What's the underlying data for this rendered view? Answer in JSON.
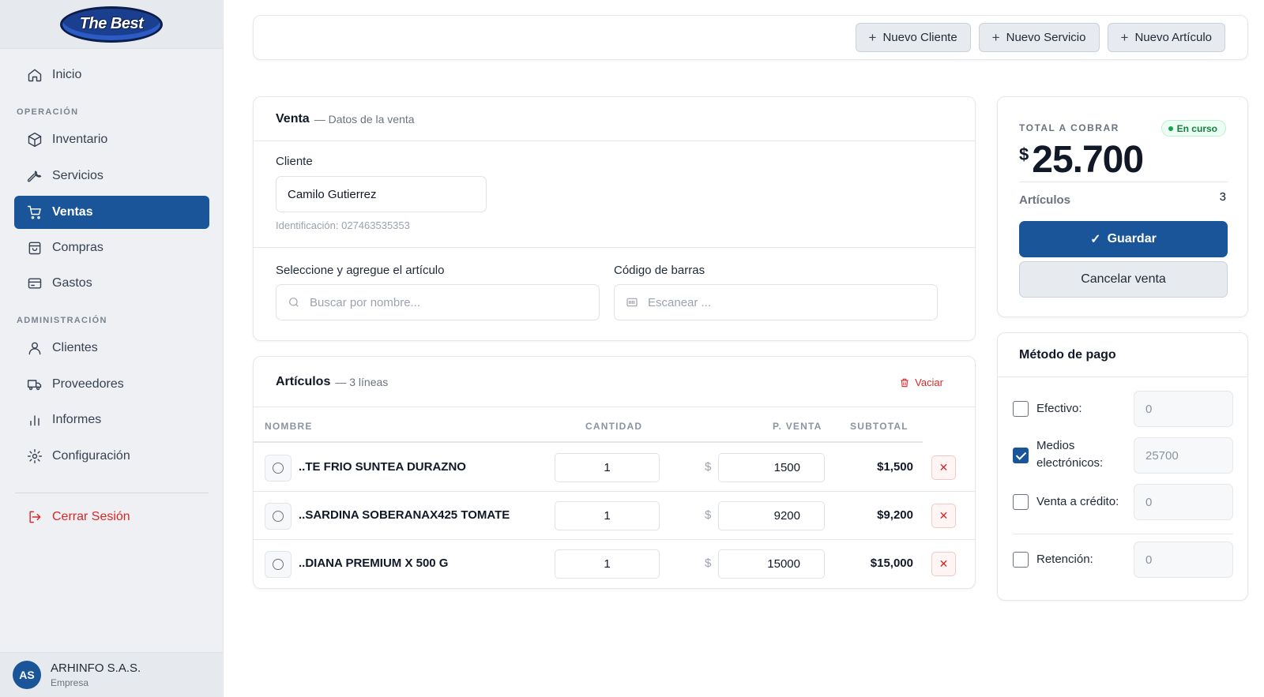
{
  "brand": {
    "logo_text": "The Best"
  },
  "sidebar": {
    "home": "Inicio",
    "section_operacion": "OPERACIÓN",
    "inventario": "Inventario",
    "servicios": "Servicios",
    "ventas": "Ventas",
    "compras": "Compras",
    "gastos": "Gastos",
    "section_admin": "ADMINISTRACIÓN",
    "clientes": "Clientes",
    "proveedores": "Proveedores",
    "informes": "Informes",
    "configuracion": "Configuración",
    "logout": "Cerrar Sesión",
    "footer": {
      "initials": "AS",
      "company": "ARHINFO S.A.S.",
      "role": "Empresa"
    }
  },
  "topbar": {
    "new_client": "Nuevo Cliente",
    "new_service": "Nuevo Servicio",
    "new_article": "Nuevo Artículo"
  },
  "venta": {
    "title": "Venta",
    "subtitle": "— Datos de la venta",
    "client_label": "Cliente",
    "client_value": "Camilo Gutierrez",
    "client_id": "Identificación: 027463535353",
    "select_label": "Seleccione y agregue el artículo",
    "search_placeholder": "Buscar por nombre...",
    "barcode_label": "Código de barras",
    "barcode_placeholder": "Escanear ..."
  },
  "articulos": {
    "title": "Artículos",
    "subtitle": "— 3 líneas",
    "clear": "Vaciar",
    "columns": {
      "name": "NOMBRE",
      "qty": "CANTIDAD",
      "price": "P. VENTA",
      "subtotal": "SUBTOTAL"
    },
    "currency": "$",
    "rows": [
      {
        "name": "..TE FRIO SUNTEA DURAZNO",
        "qty": "1",
        "price": "1500",
        "subtotal": "$1,500"
      },
      {
        "name": "..SARDINA SOBERANAX425 TOMATE",
        "qty": "1",
        "price": "9200",
        "subtotal": "$9,200"
      },
      {
        "name": "..DIANA PREMIUM X 500 G",
        "qty": "1",
        "price": "15000",
        "subtotal": "$15,000"
      }
    ]
  },
  "total": {
    "label": "TOTAL A COBRAR",
    "status": "En curso",
    "currency": "$",
    "amount": "25.700",
    "items_label": "Artículos",
    "items_count": "3",
    "save": "Guardar",
    "cancel": "Cancelar venta"
  },
  "payment": {
    "title": "Método de pago",
    "methods": [
      {
        "label": "Efectivo:",
        "value": "0",
        "checked": false
      },
      {
        "label": "Medios electrónicos:",
        "value": "25700",
        "checked": true
      },
      {
        "label": "Venta a crédito:",
        "value": "0",
        "checked": false
      },
      {
        "label": "Retención:",
        "value": "0",
        "checked": false
      }
    ]
  },
  "colors": {
    "primary": "#1a5499",
    "danger": "#dc2626",
    "success": "#15803d"
  }
}
